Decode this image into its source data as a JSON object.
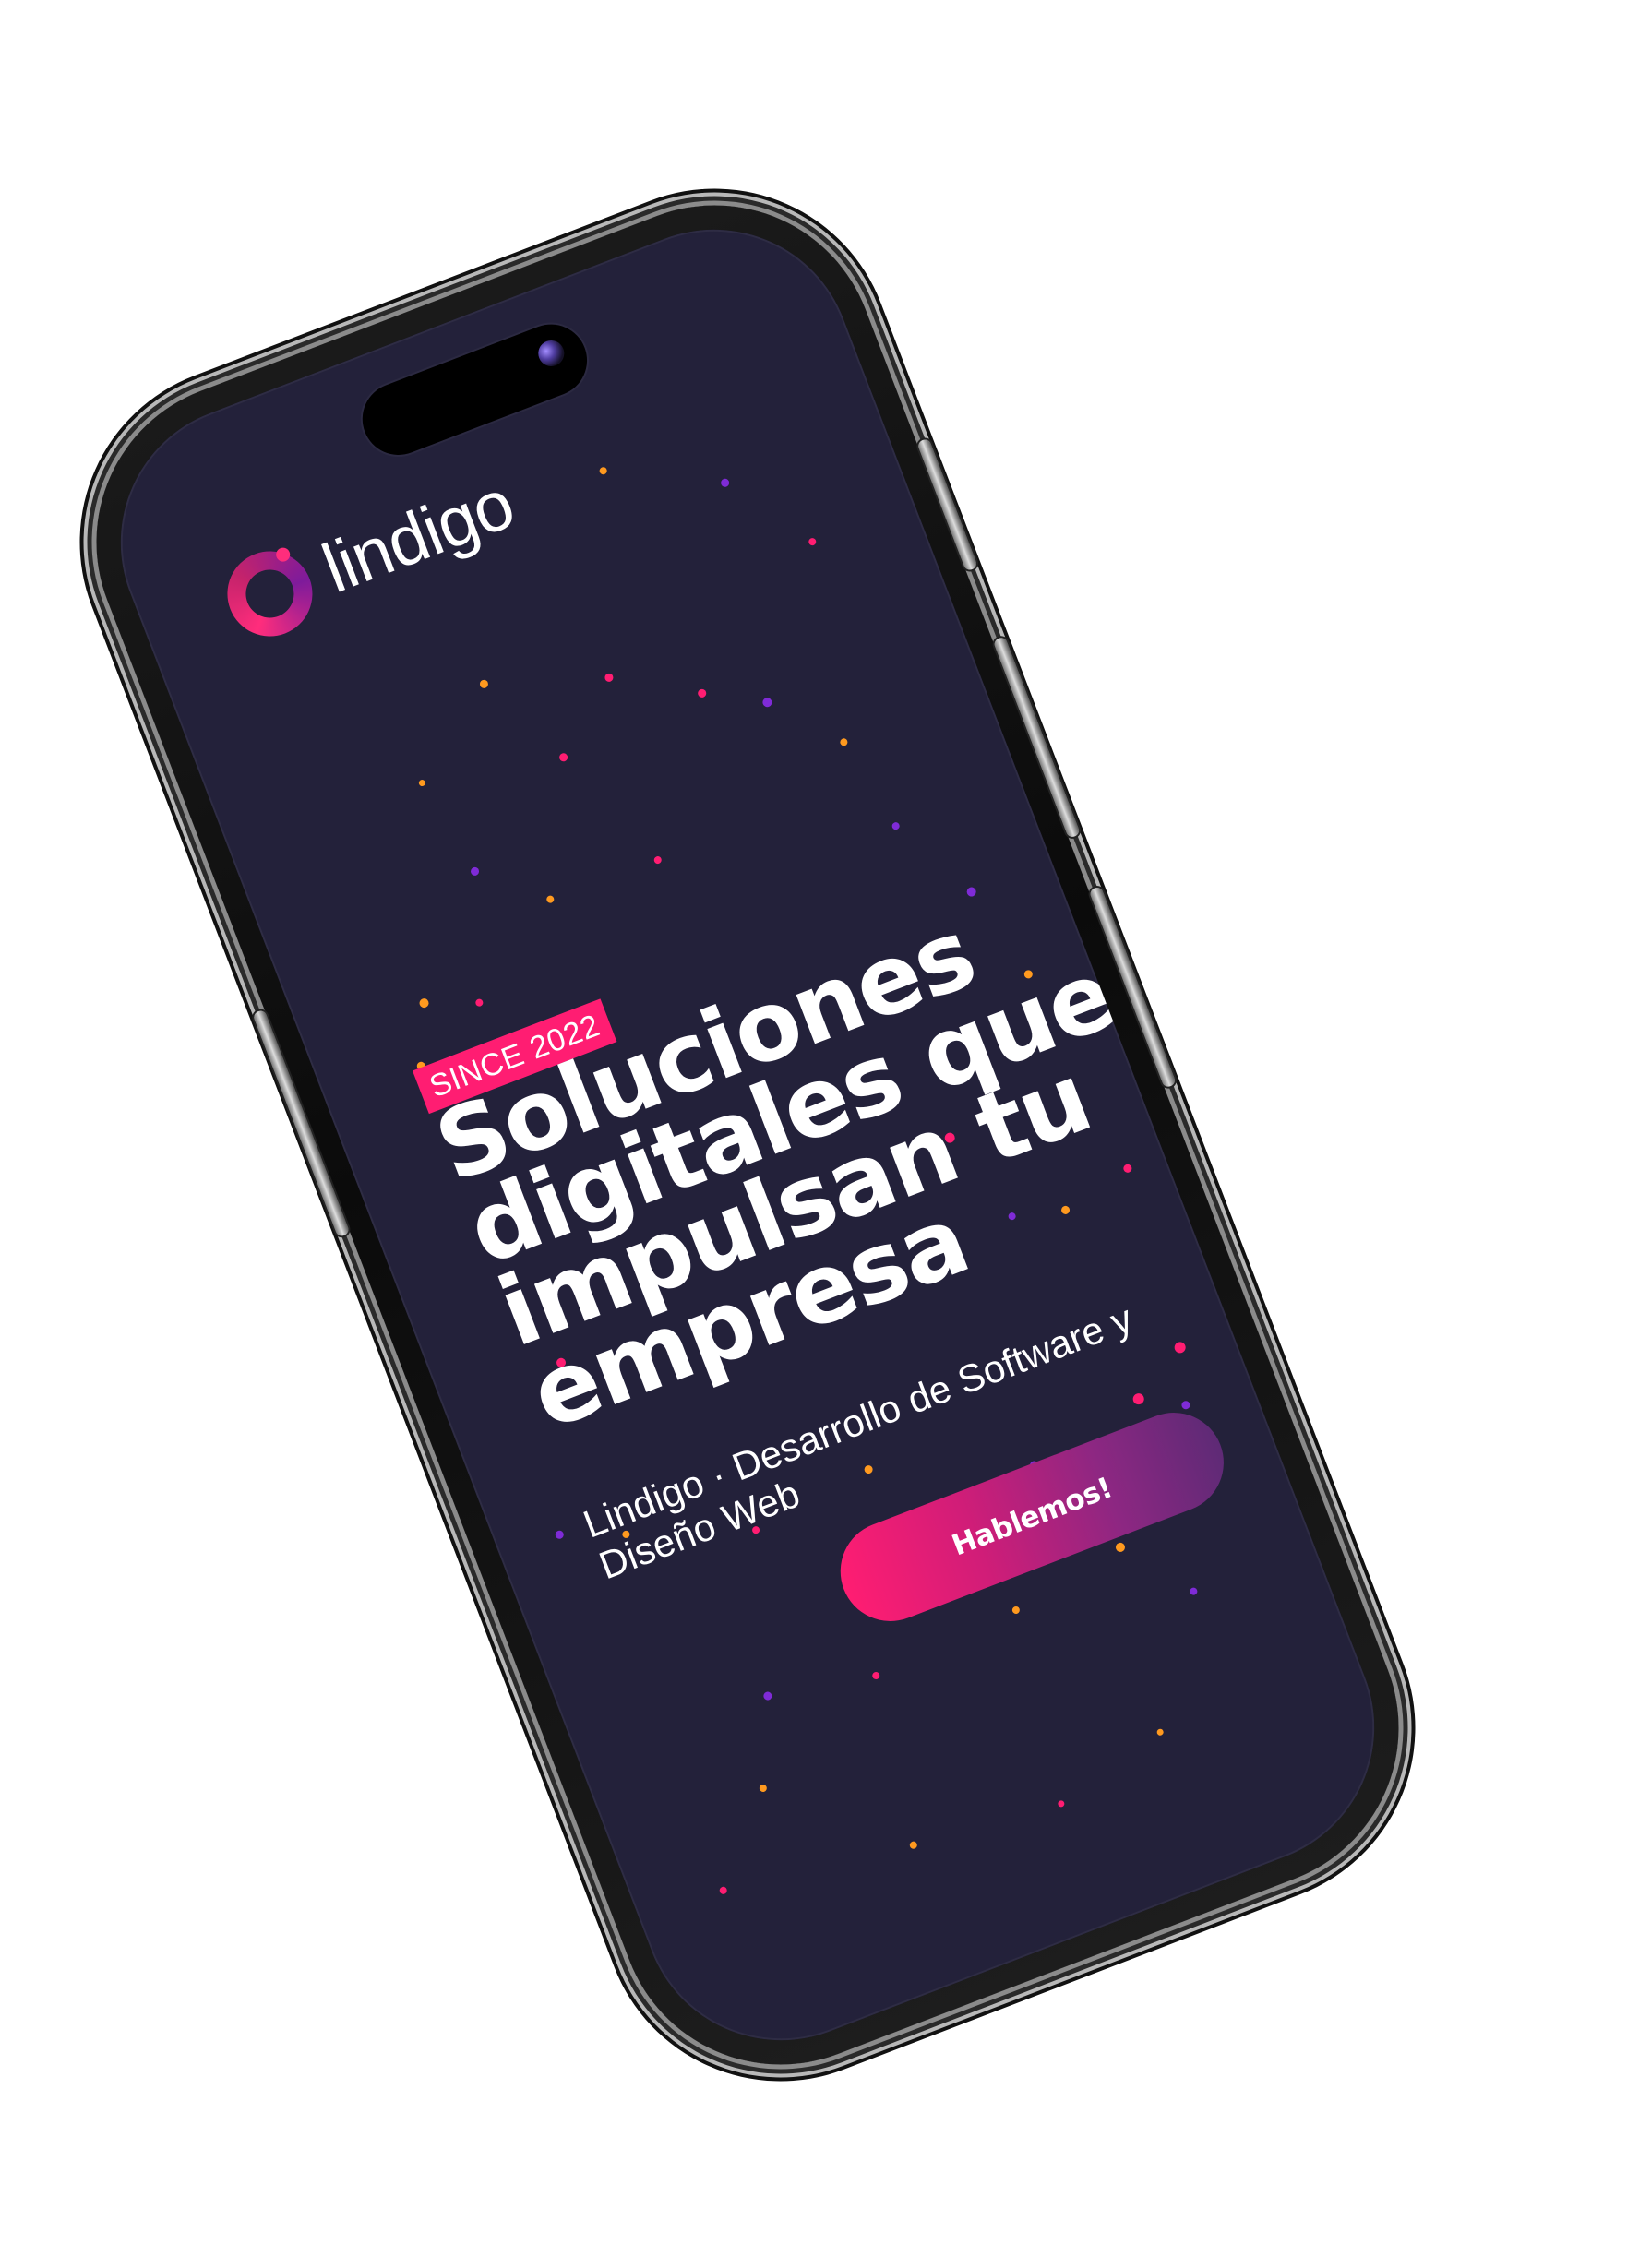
{
  "brand": {
    "name": "lindigo",
    "logo_icon": "ring-logo-icon",
    "accent": "#ff1d72",
    "secondary": "#6f2c8f",
    "background": "#23213a"
  },
  "hero": {
    "badge": "SINCE 2022",
    "headline_lines": [
      "Soluciones",
      "digitales que",
      "impulsan tu",
      "empresa"
    ],
    "subtitle": "Lindigo · Desarrollo de Software y Diseño Web",
    "cta_label": "Hablemos!"
  },
  "device": {
    "camera_icon": "camera-icon"
  }
}
